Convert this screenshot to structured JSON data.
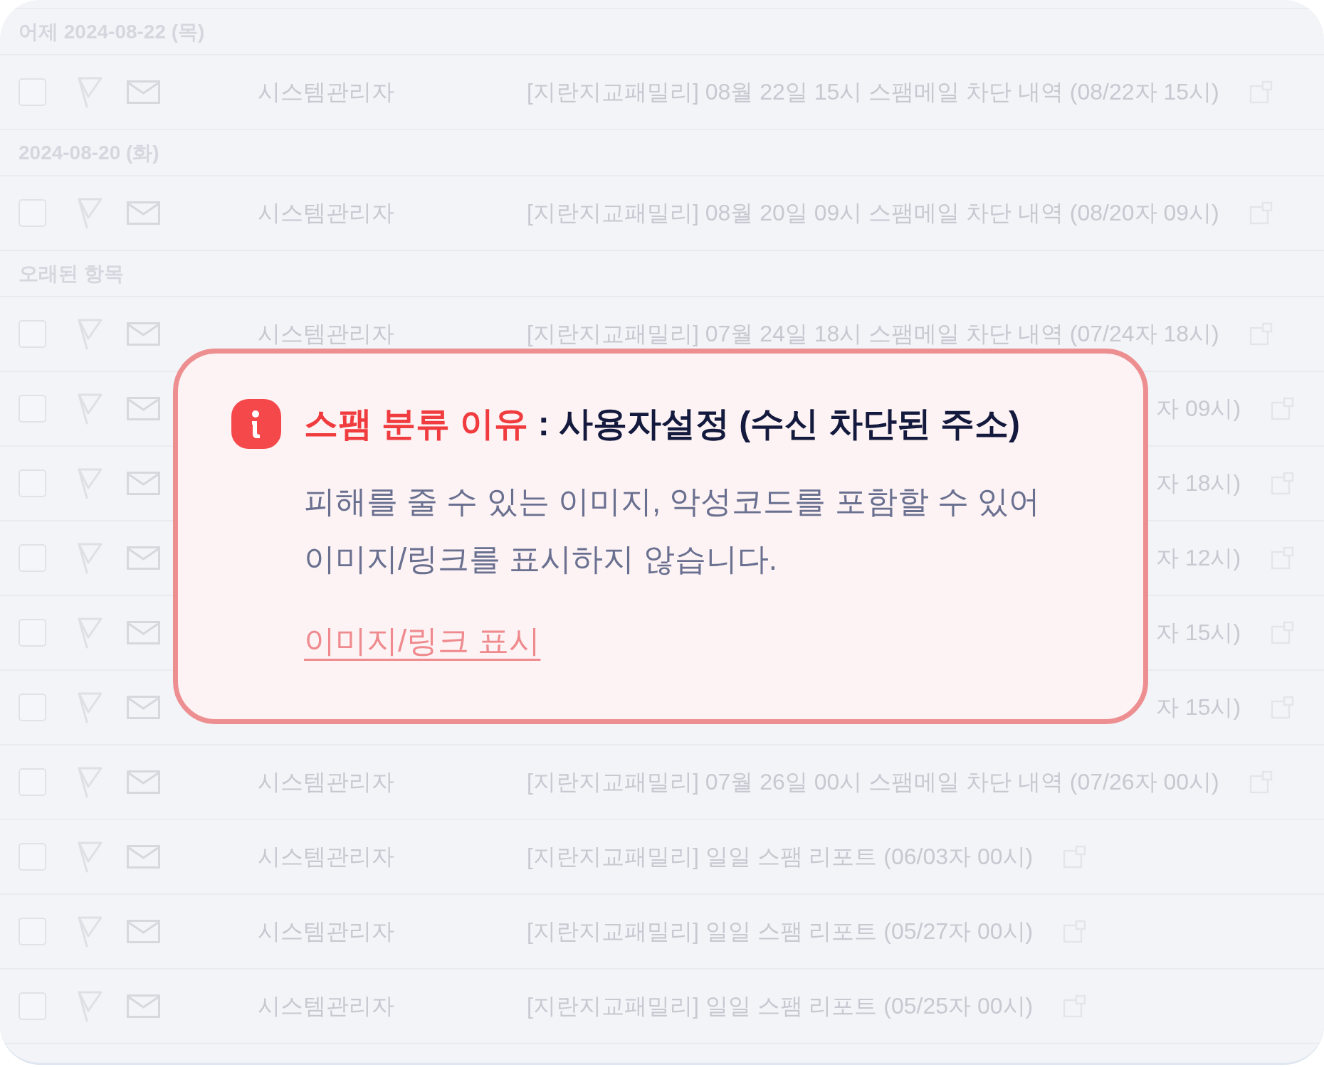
{
  "sections": [
    {
      "title": "어제 2024-08-22 (목)",
      "messages": [
        {
          "kind": "full",
          "checked": false,
          "flagged": false,
          "sender": "시스템관리자",
          "subject": "[지란지교패밀리] 08월 22일 15시 스팸메일 차단 내역 (08/22자 15시)"
        }
      ]
    },
    {
      "title": "2024-08-20 (화)",
      "messages": [
        {
          "kind": "full",
          "checked": false,
          "flagged": false,
          "sender": "시스템관리자",
          "subject": "[지란지교패밀리] 08월 20일 09시 스팸메일 차단 내역 (08/20자 09시)"
        }
      ]
    },
    {
      "title": "오래된 항목",
      "messages": [
        {
          "kind": "full",
          "checked": false,
          "flagged": false,
          "sender": "시스템관리자",
          "subject": "[지란지교패밀리] 07월 24일 18시 스팸메일 차단 내역 (07/24자 18시)"
        },
        {
          "kind": "clipped",
          "checked": false,
          "flagged": false,
          "subject": "자 09시)"
        },
        {
          "kind": "clipped",
          "checked": false,
          "flagged": false,
          "subject": "자 18시)"
        },
        {
          "kind": "clipped",
          "checked": false,
          "flagged": false,
          "subject": "자 12시)"
        },
        {
          "kind": "clipped",
          "checked": false,
          "flagged": false,
          "subject": "자 15시)"
        },
        {
          "kind": "clipped",
          "checked": false,
          "flagged": false,
          "subject": "자 15시)"
        },
        {
          "kind": "full",
          "checked": false,
          "flagged": false,
          "sender": "시스템관리자",
          "subject": "[지란지교패밀리] 07월 26일 00시 스팸메일 차단 내역 (07/26자 00시)"
        },
        {
          "kind": "full",
          "checked": false,
          "flagged": false,
          "sender": "시스템관리자",
          "subject": "[지란지교패밀리] 일일 스팸 리포트 (06/03자 00시)"
        },
        {
          "kind": "full",
          "checked": false,
          "flagged": false,
          "sender": "시스템관리자",
          "subject": "[지란지교패밀리] 일일 스팸 리포트 (05/27자 00시)"
        },
        {
          "kind": "full",
          "checked": false,
          "flagged": false,
          "sender": "시스템관리자",
          "subject": "[지란지교패밀리] 일일 스팸 리포트 (05/25자 00시)"
        }
      ]
    }
  ],
  "notice": {
    "label": "스팸 분류 이유",
    "reason": ": 사용자설정 (수신 차단된 주소)",
    "message": "피해를 줄 수 있는 이미지, 악성코드를 포함할 수 있어\n이미지/링크를 표시하지 않습니다.",
    "link": "이미지/링크 표시"
  }
}
